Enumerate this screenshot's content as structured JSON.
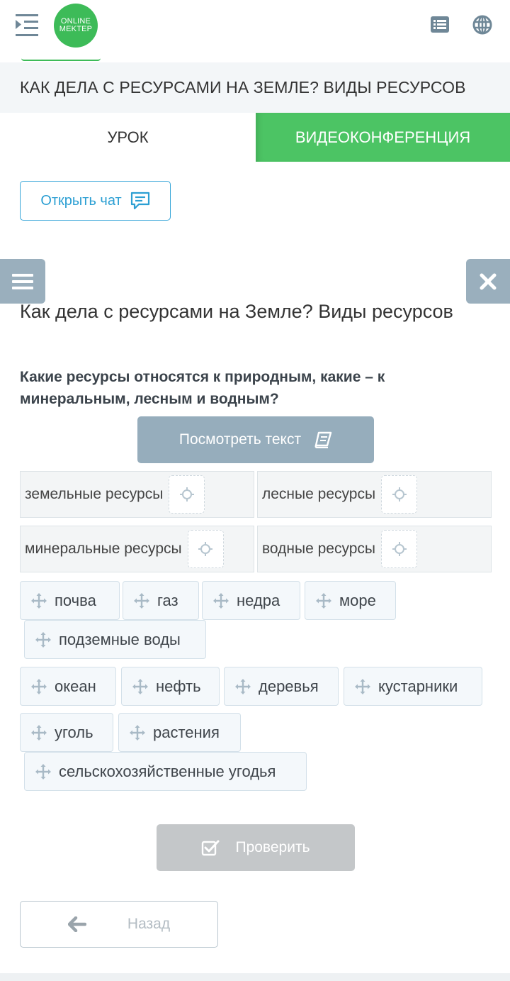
{
  "header": {
    "logo_line1": "ONLINE",
    "logo_line2": "MEKTEP",
    "icons": [
      "menu-toggle-icon",
      "list-icon",
      "globe-icon"
    ]
  },
  "lesson": {
    "title": "КАК ДЕЛА С РЕСУРСАМИ НА ЗЕМЛЕ? ВИДЫ РЕСУРСОВ"
  },
  "tabs": [
    {
      "label": "УРОК",
      "active": true
    },
    {
      "label": "ВИДЕОКОНФЕРЕНЦИЯ",
      "active": false
    }
  ],
  "chat": {
    "label": "Открыть чат"
  },
  "main": {
    "title": "Как дела с ресурсами на Земле? Виды ресурсов",
    "question": "Какие ресурсы относятся к природным, какие – к минеральным, лесным и водным?",
    "view_text_label": "Посмотреть текст"
  },
  "zones": [
    {
      "label": "земельные ресурсы"
    },
    {
      "label": "лесные ресурсы"
    },
    {
      "label": "минеральные ресурсы"
    },
    {
      "label": "водные ресурсы"
    }
  ],
  "chips": [
    {
      "label": "почва"
    },
    {
      "label": "газ"
    },
    {
      "label": "недра"
    },
    {
      "label": "море"
    },
    {
      "label": "подземные воды"
    },
    {
      "label": "океан"
    },
    {
      "label": "нефть"
    },
    {
      "label": "деревья"
    },
    {
      "label": "кустарники"
    },
    {
      "label": "уголь"
    },
    {
      "label": "растения"
    },
    {
      "label": "сельскохозяйственные угодья"
    }
  ],
  "actions": {
    "check_label": "Проверить",
    "back_label": "Назад"
  },
  "colors": {
    "brand_green": "#3dbb58",
    "tab_green": "#4cc464",
    "chat_blue": "#2c9fd3",
    "slate_button": "#96adbc",
    "disabled_gray": "#c4c7c9"
  }
}
